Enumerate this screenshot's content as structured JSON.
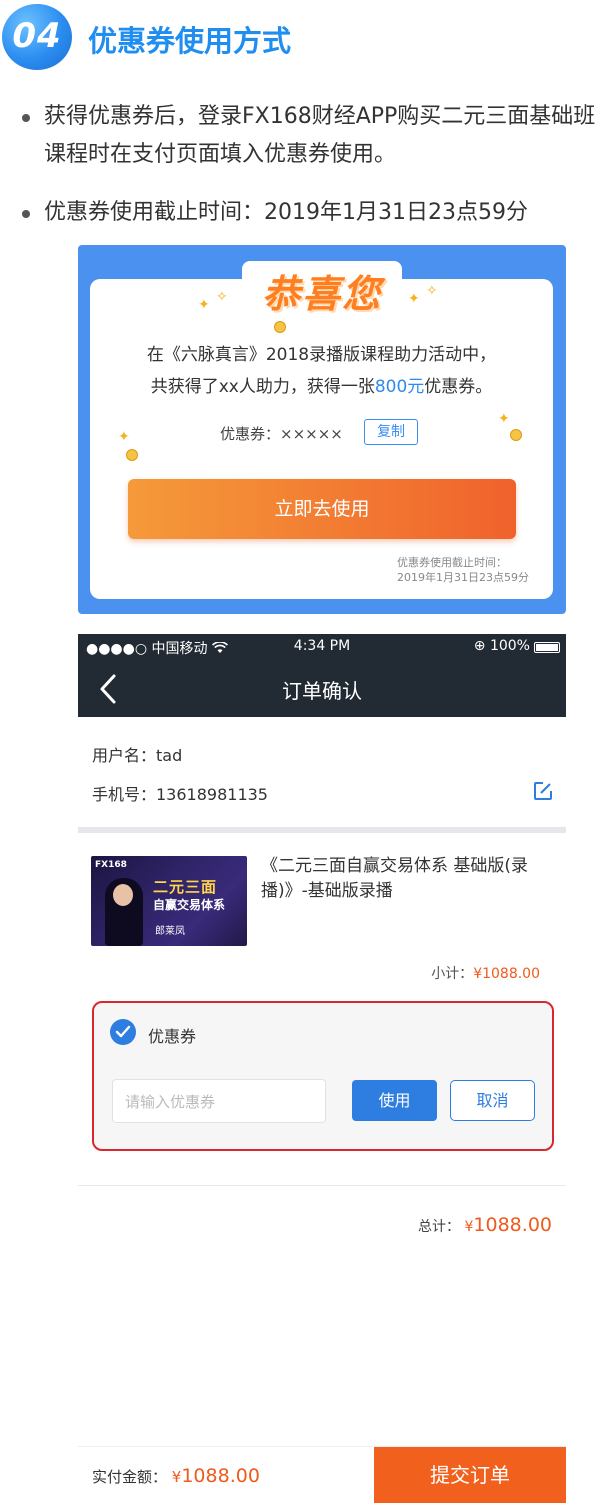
{
  "header": {
    "number": "04",
    "title": "优惠券使用方式"
  },
  "bullets": [
    "获得优惠券后，登录FX168财经APP购买二元三面基础班课程时在支付页面填入优惠券使用。",
    "优惠券使用截止时间：2019年1月31日23点59分"
  ],
  "card": {
    "congrats": "恭喜您",
    "msg_line1": "在《六脉真言》2018录播版课程助力活动中，",
    "msg_line2_pre": "共获得了xx人助力，获得一张",
    "msg_line2_amount": "800元",
    "msg_line2_post": "优惠券。",
    "code_label": "优惠券：×××××",
    "copy_button": "复制",
    "use_button": "立即去使用",
    "expire_line1": "优惠券使用截止时间：",
    "expire_line2": "2019年1月31日23点59分",
    "accent": "#4b92f0"
  },
  "phone": {
    "status": {
      "signal": "●●●●○ 中国移动 ",
      "wifi": "wifi-icon",
      "time": "4:34 PM",
      "battery": "⊕ 100%"
    },
    "nav_title": "订单确认",
    "username": "用户名：tad",
    "phone_number": "手机号：13618981135",
    "course": {
      "image_title": "二元三面",
      "image_subtitle": "自赢交易体系",
      "image_name": "郎莱凤",
      "image_logo": "FX168",
      "title": "《二元三面自赢交易体系 基础版(录播)》-基础版录播"
    },
    "subtotal_label": "小计：",
    "subtotal_value": "¥1088.00",
    "coupon": {
      "label": "优惠券",
      "placeholder": "请输入优惠券",
      "use_button": "使用",
      "cancel_button": "取消"
    },
    "total_label": "总计：",
    "total_symbol": "¥",
    "total_value": "1088.00",
    "pay_label": "实付金额：",
    "pay_symbol": "¥",
    "pay_value": "1088.00",
    "submit_button": "提交订单",
    "colors": {
      "bar": "#222a33",
      "primary": "#2e7de0",
      "orange": "#f2601d",
      "highlight_border": "#d9272e"
    }
  }
}
